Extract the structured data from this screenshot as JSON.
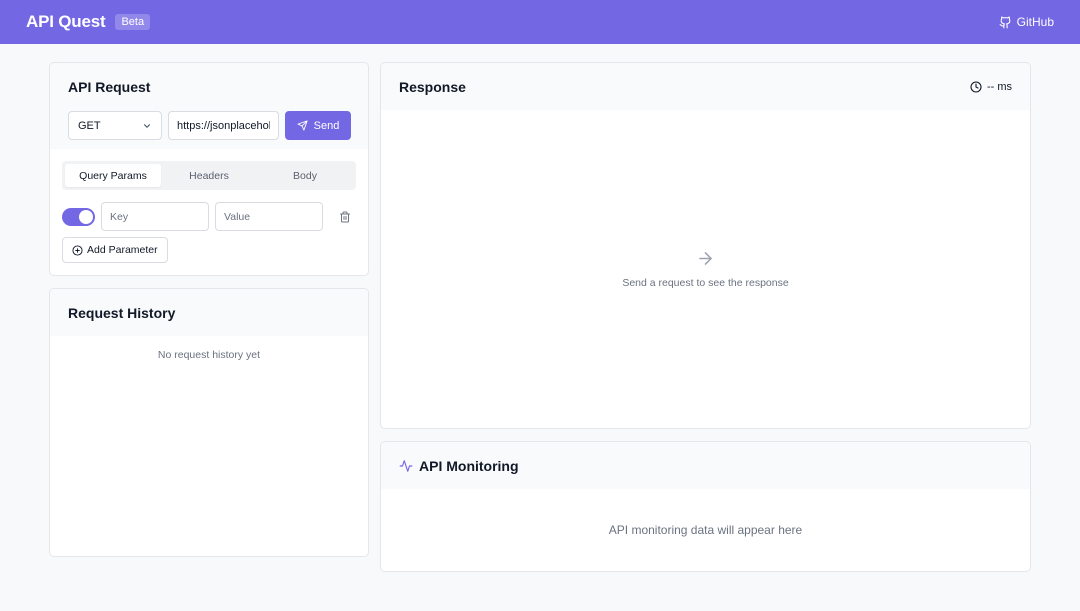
{
  "header": {
    "title": "API Quest",
    "badge": "Beta",
    "github_label": "GitHub",
    "accent_color": "#7467e4"
  },
  "request": {
    "title": "API Request",
    "method": "GET",
    "url": "https://jsonplaceholder.typicode.com",
    "send_label": "Send",
    "tabs": [
      {
        "label": "Query Params",
        "active": true
      },
      {
        "label": "Headers",
        "active": false
      },
      {
        "label": "Body",
        "active": false
      }
    ],
    "param": {
      "enabled": true,
      "key_placeholder": "Key",
      "value_placeholder": "Value"
    },
    "add_param_label": "Add Parameter"
  },
  "history": {
    "title": "Request History",
    "empty_text": "No request history yet"
  },
  "response": {
    "title": "Response",
    "time_readout": "-- ms",
    "empty_text": "Send a request to see the response"
  },
  "monitoring": {
    "title": "API Monitoring",
    "empty_text": "API monitoring data will appear here"
  },
  "icons": {
    "github": "github-icon",
    "chevron": "chevron-down-icon",
    "send": "send-icon",
    "trash": "trash-icon",
    "add": "plus-circle-icon",
    "clock": "clock-icon",
    "arrow": "arrow-right-icon",
    "activity": "activity-icon"
  }
}
